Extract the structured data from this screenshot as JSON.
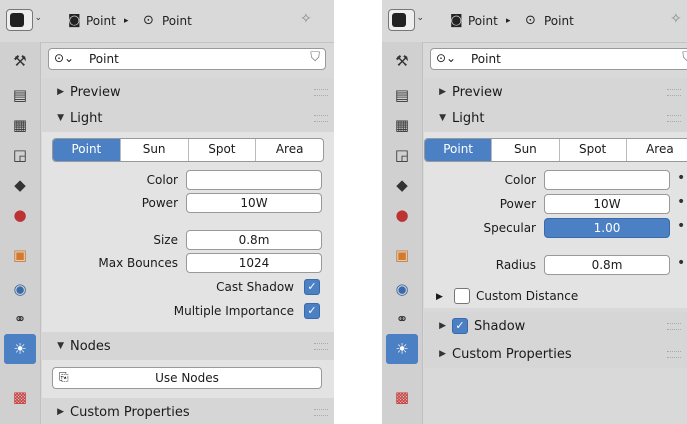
{
  "left": {
    "header": {
      "crumb1": "Point",
      "crumb2": "Point"
    },
    "object_name": "Point",
    "sections": {
      "preview": "Preview",
      "light": "Light",
      "nodes": "Nodes",
      "custom": "Custom Properties"
    },
    "light_types": [
      "Point",
      "Sun",
      "Spot",
      "Area"
    ],
    "fields": {
      "color_label": "Color",
      "power_label": "Power",
      "power_value": "10W",
      "size_label": "Size",
      "size_value": "0.8m",
      "bounces_label": "Max Bounces",
      "bounces_value": "1024",
      "cast_shadow": "Cast Shadow",
      "multi_importance": "Multiple Importance"
    },
    "use_nodes": "Use Nodes"
  },
  "right": {
    "header": {
      "crumb1": "Point",
      "crumb2": "Point"
    },
    "object_name": "Point",
    "sections": {
      "preview": "Preview",
      "light": "Light",
      "shadow": "Shadow",
      "custom": "Custom Properties"
    },
    "light_types": [
      "Point",
      "Sun",
      "Spot",
      "Area"
    ],
    "fields": {
      "color_label": "Color",
      "power_label": "Power",
      "power_value": "10W",
      "specular_label": "Specular",
      "specular_value": "1.00",
      "radius_label": "Radius",
      "radius_value": "0.8m",
      "custom_distance": "Custom Distance"
    }
  },
  "icons": {
    "accent": "#4c80c4"
  }
}
